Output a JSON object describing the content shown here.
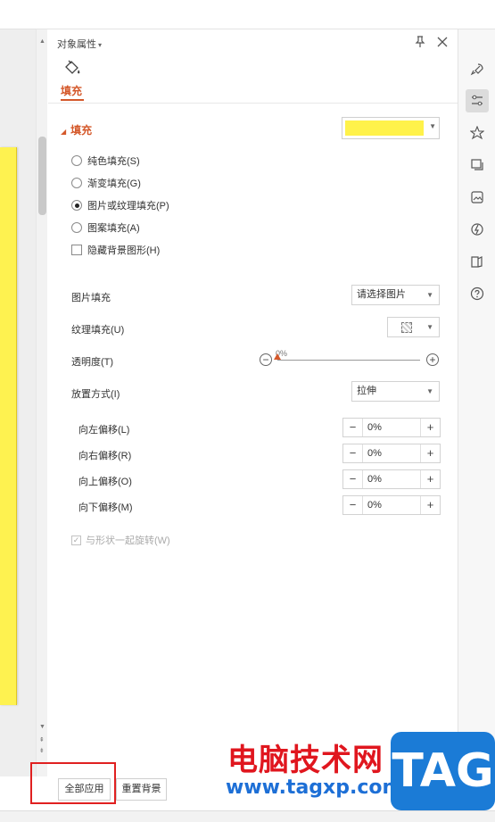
{
  "panel": {
    "title": "对象属性",
    "tab_label": "填充",
    "fill_section": {
      "title": "填充",
      "color": "#fff24a",
      "options": [
        {
          "label": "纯色填充(S)",
          "selected": false
        },
        {
          "label": "渐变填充(G)",
          "selected": false
        },
        {
          "label": "图片或纹理填充(P)",
          "selected": true
        },
        {
          "label": "图案填充(A)",
          "selected": false
        }
      ],
      "hide_bg_label": "隐藏背景图形(H)"
    },
    "picture_fill": {
      "label": "图片填充",
      "value": "请选择图片"
    },
    "texture_fill": {
      "label": "纹理填充(U)"
    },
    "transparency": {
      "label": "透明度(T)",
      "value": "0%",
      "percent": 0
    },
    "placement": {
      "label": "放置方式(I)",
      "value": "拉伸"
    },
    "offsets": [
      {
        "label": "向左偏移(L)",
        "value": "0%"
      },
      {
        "label": "向右偏移(R)",
        "value": "0%"
      },
      {
        "label": "向上偏移(O)",
        "value": "0%"
      },
      {
        "label": "向下偏移(M)",
        "value": "0%"
      }
    ],
    "rotate_with_shape": {
      "label": "与形状一起旋转(W)",
      "checked": true,
      "disabled": true
    }
  },
  "bottom": {
    "apply_all": "全部应用",
    "reset_bg": "重置背景"
  },
  "right_rail": {
    "icons": [
      "rocket-icon",
      "sliders-icon",
      "star-icon",
      "slideshow-icon",
      "image-icon",
      "lightning-icon",
      "book-icon",
      "help-icon"
    ]
  },
  "watermark": {
    "cn": "电脑技术网",
    "url": "www.tagxp.com",
    "tag": "TAG"
  },
  "colors": {
    "accent": "#d4582a",
    "slide_yellow": "#fef250",
    "highlight": "#e02020"
  }
}
